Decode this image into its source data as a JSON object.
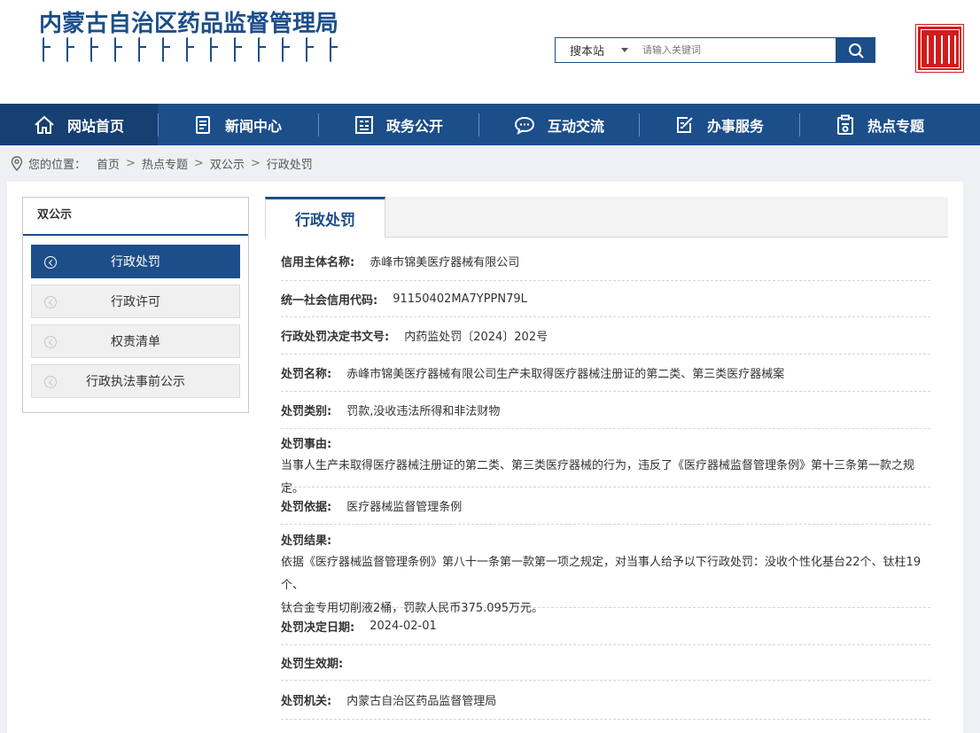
{
  "header": {
    "site_title": "内蒙古自治区药品监督管理局",
    "search": {
      "scope_label": "搜本站",
      "placeholder": "请输入关键词"
    }
  },
  "nav": {
    "items": [
      {
        "label": "网站首页",
        "icon": "home-icon"
      },
      {
        "label": "新闻中心",
        "icon": "news-icon"
      },
      {
        "label": "政务公开",
        "icon": "building-icon"
      },
      {
        "label": "互动交流",
        "icon": "chat-icon"
      },
      {
        "label": "办事服务",
        "icon": "edit-icon"
      },
      {
        "label": "热点专题",
        "icon": "clipboard-icon"
      }
    ]
  },
  "breadcrumb": {
    "prefix": "您的位置：",
    "items": [
      "首页",
      "热点专题",
      "双公示",
      "行政处罚"
    ],
    "separator": ">"
  },
  "sidebar": {
    "title": "双公示",
    "items": [
      {
        "label": "行政处罚",
        "active": true
      },
      {
        "label": "行政许可",
        "active": false
      },
      {
        "label": "权责清单",
        "active": false
      },
      {
        "label": "行政执法事前公示",
        "active": false
      }
    ]
  },
  "content": {
    "tab_label": "行政处罚",
    "fields": {
      "credit_subject": {
        "label": "信用主体名称:",
        "value": "赤峰市锦美医疗器械有限公司"
      },
      "credit_code": {
        "label": "统一社会信用代码:",
        "value": "91150402MA7YPPN79L"
      },
      "decision_no": {
        "label": "行政处罚决定书文号:",
        "value": "内药监处罚〔2024〕202号"
      },
      "penalty_name": {
        "label": "处罚名称:",
        "value": "赤峰市锦美医疗器械有限公司生产未取得医疗器械注册证的第二类、第三类医疗器械案"
      },
      "penalty_type": {
        "label": "处罚类别:",
        "value": "罚款,没收违法所得和非法财物"
      },
      "penalty_reason": {
        "label": "处罚事由:",
        "value": "当事人生产未取得医疗器械注册证的第二类、第三类医疗器械的行为，违反了《医疗器械监督管理条例》第十三条第一款之规定。"
      },
      "penalty_basis": {
        "label": "处罚依据:",
        "value": "医疗器械监督管理条例"
      },
      "penalty_result": {
        "label": "处罚结果:",
        "value_line1": "依据《医疗器械监督管理条例》第八十一条第一款第一项之规定，对当事人给予以下行政处罚：没收个性化基台22个、钛柱19个、",
        "value_line2": "钛合金专用切削液2桶，罚款人民币375.095万元。"
      },
      "decision_date": {
        "label": "处罚决定日期:",
        "value": "2024-02-01"
      },
      "effective_date": {
        "label": "处罚生效期:",
        "value": ""
      },
      "authority": {
        "label": "处罚机关:",
        "value": "内蒙古自治区药品监督管理局"
      }
    }
  },
  "colors": {
    "brand_blue": "#1c4e8a",
    "nav_active": "#163f72",
    "seal_red": "#d21c1c"
  }
}
